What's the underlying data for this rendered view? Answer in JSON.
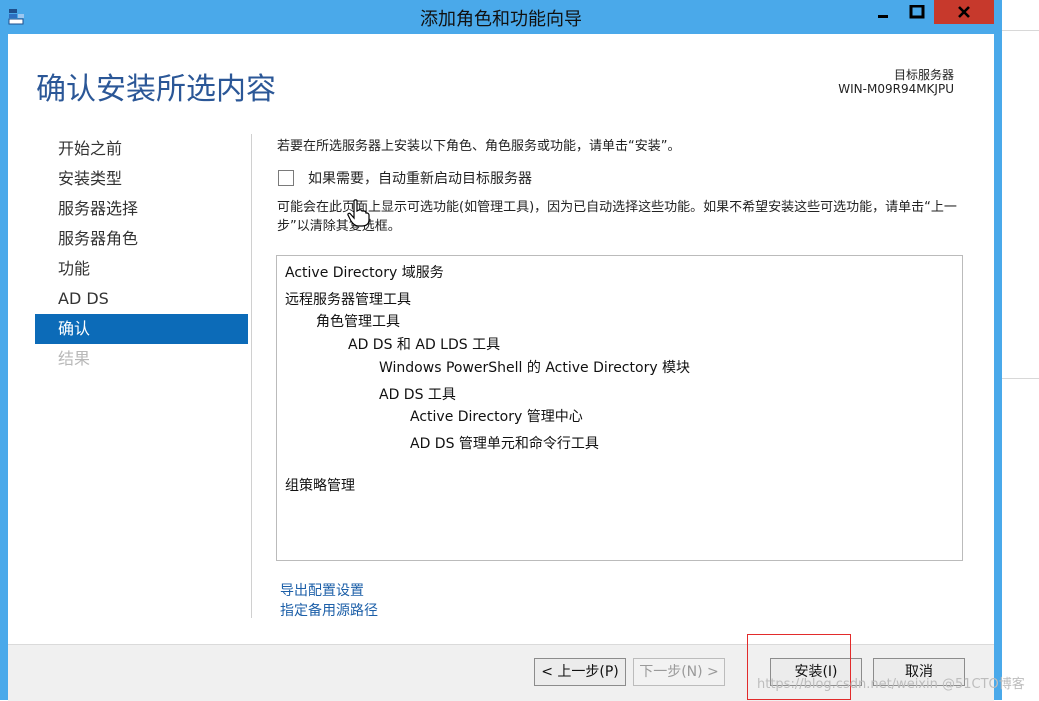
{
  "window": {
    "title": "添加角色和功能向导",
    "controls": {
      "minimize": "minimize-icon",
      "maximize": "maximize-icon",
      "close": "close-icon"
    },
    "colors": {
      "titlebar": "#4aa9ea",
      "close": "#c7392c",
      "accent": "#0c6bb8"
    }
  },
  "header": {
    "page_title": "确认安装所选内容",
    "target_server_label": "目标服务器",
    "target_server_name": "WIN-M09R94MKJPU"
  },
  "sidebar": {
    "items": [
      {
        "label": "开始之前",
        "state": "normal"
      },
      {
        "label": "安装类型",
        "state": "normal"
      },
      {
        "label": "服务器选择",
        "state": "normal"
      },
      {
        "label": "服务器角色",
        "state": "normal"
      },
      {
        "label": "功能",
        "state": "normal"
      },
      {
        "label": "AD DS",
        "state": "normal"
      },
      {
        "label": "确认",
        "state": "active"
      },
      {
        "label": "结果",
        "state": "disabled"
      }
    ]
  },
  "main": {
    "intro": "若要在所选服务器上安装以下角色、角色服务或功能，请单击“安装”。",
    "restart_checkbox": {
      "label": "如果需要，自动重新启动目标服务器",
      "checked": false
    },
    "note": "可能会在此页面上显示可选功能(如管理工具)，因为已自动选择这些功能。如果不希望安装这些可选功能，请单击“上一步”以清除其复选框。",
    "selection_list": [
      "Active Directory 域服务",
      "远程服务器管理工具",
      "角色管理工具",
      "AD DS 和 AD LDS 工具",
      "Windows PowerShell 的 Active Directory 模块",
      "AD DS 工具",
      "Active Directory 管理中心",
      "AD DS 管理单元和命令行工具",
      "组策略管理"
    ],
    "links": {
      "export": "导出配置设置",
      "alt_source": "指定备用源路径"
    }
  },
  "footer": {
    "previous": "< 上一步(P)",
    "next": "下一步(N) >",
    "install": "安装(I)",
    "cancel": "取消"
  },
  "watermark": "https://blog.csdn.net/weixin @51CTO博客"
}
